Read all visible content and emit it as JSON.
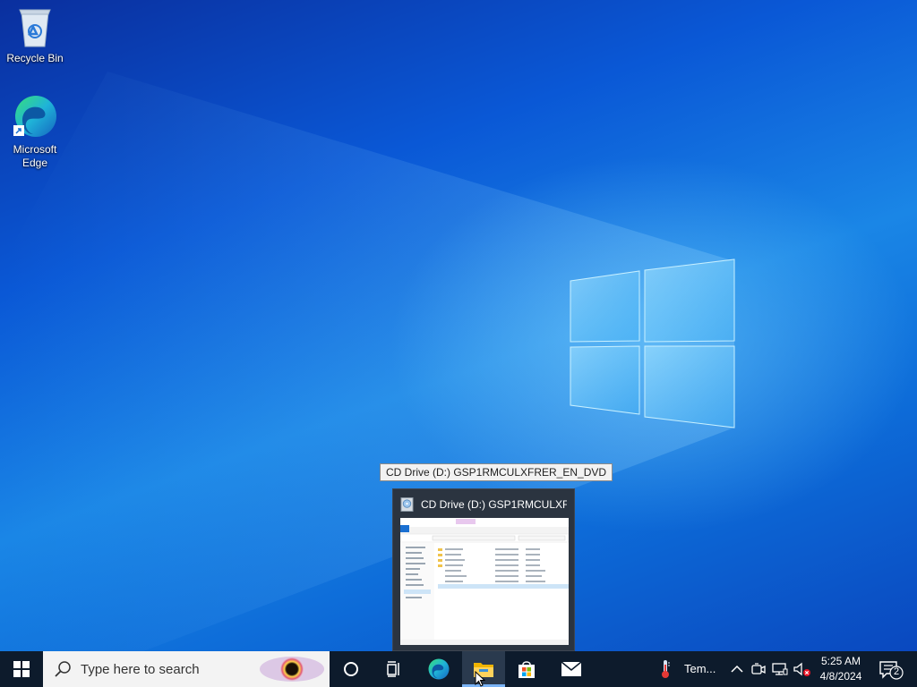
{
  "desktop": {
    "icons": [
      {
        "label": "Recycle Bin",
        "icon": "recycle-bin-icon"
      },
      {
        "label": "Microsoft Edge",
        "icon": "edge-icon"
      }
    ]
  },
  "tooltip": {
    "text": "CD Drive (D:) GSP1RMCULXFRER_EN_DVD"
  },
  "thumbnail": {
    "title": "CD Drive (D:) GSP1RMCULXF..."
  },
  "taskbar": {
    "search_placeholder": "Type here to search",
    "pinned": [
      {
        "name": "start-button",
        "icon": "windows-logo-icon"
      },
      {
        "name": "cortana-button",
        "icon": "circle-icon"
      },
      {
        "name": "task-view-button",
        "icon": "task-view-icon"
      },
      {
        "name": "edge-taskbar-button",
        "icon": "edge-icon"
      },
      {
        "name": "file-explorer-button",
        "icon": "folder-icon",
        "active": true
      },
      {
        "name": "store-button",
        "icon": "store-icon"
      },
      {
        "name": "mail-button",
        "icon": "mail-icon"
      }
    ],
    "weather": {
      "label": "Tem...",
      "icon": "thermometer-icon"
    },
    "tray": [
      "chevron-up-icon",
      "meet-now-icon",
      "network-icon",
      "volume-muted-icon"
    ],
    "clock": {
      "time": "5:25 AM",
      "date": "4/8/2024"
    },
    "notifications": {
      "count": "2",
      "icon": "action-center-icon"
    }
  },
  "colors": {
    "taskbar": "#0d1b2c",
    "accent": "#0078d7",
    "search_bg": "#f3f3f3"
  }
}
